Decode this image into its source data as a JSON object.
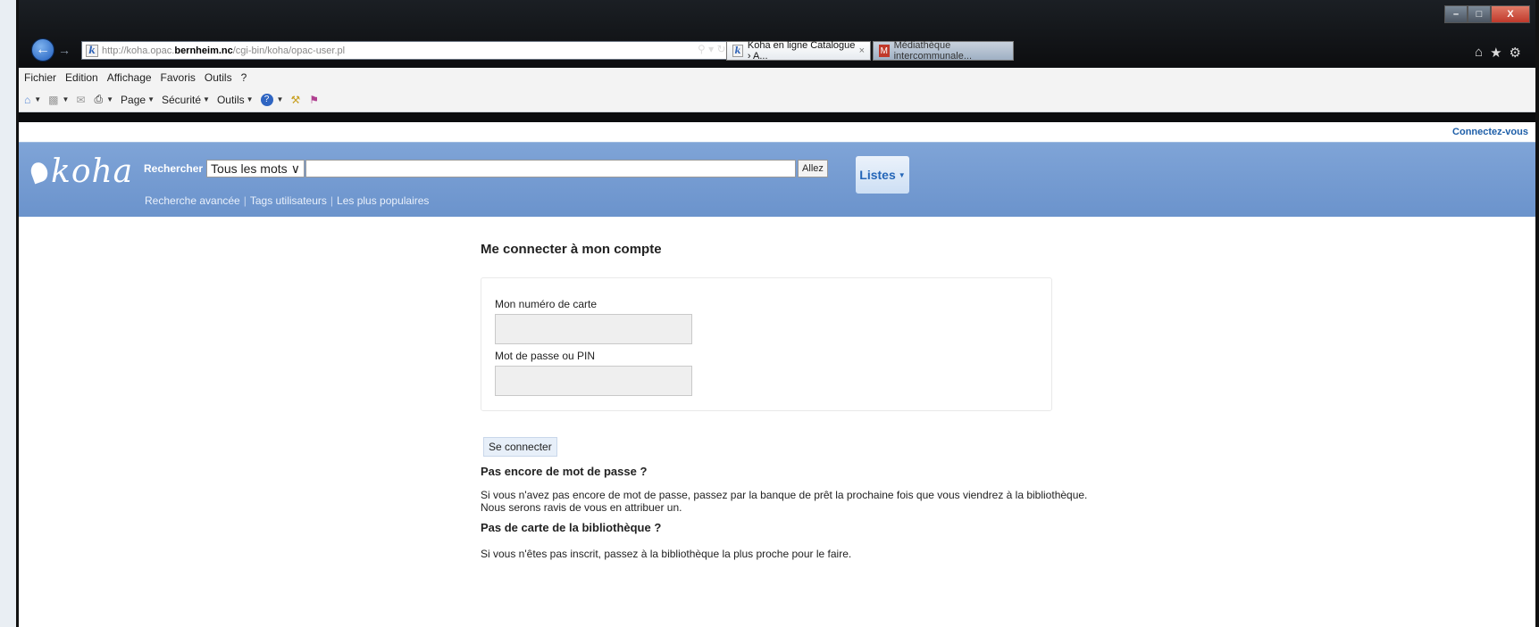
{
  "browser": {
    "address": {
      "prefix": "http://koha.opac.",
      "host": "bernheim.nc",
      "path": "/cgi-bin/koha/opac-user.pl"
    },
    "tabs": [
      {
        "label": "Koha en ligne Catalogue › A...",
        "close": "×"
      },
      {
        "label": "Médiathèque intercommunale..."
      }
    ],
    "menu": [
      "Fichier",
      "Edition",
      "Affichage",
      "Favoris",
      "Outils",
      "?"
    ],
    "command_bar": {
      "page": "Page",
      "security": "Sécurité",
      "tools": "Outils"
    },
    "caption": {
      "min": "–",
      "max": "□",
      "close": "X"
    }
  },
  "header": {
    "login_link": "Connectez-vous",
    "logo": "koha",
    "search_label": "Rechercher",
    "search_scope": "Tous les mots",
    "go_button": "Allez",
    "lists_button": "Listes",
    "sub_links": [
      "Recherche avancée",
      "Tags utilisateurs",
      "Les plus populaires"
    ]
  },
  "login": {
    "title": "Me connecter à mon compte",
    "card_label": "Mon numéro de carte",
    "password_label": "Mot de passe ou PIN",
    "submit": "Se connecter",
    "no_password_title": "Pas encore de mot de passe ?",
    "no_password_text_1": "Si vous n'avez pas encore de mot de passe, passez par la banque de prêt la prochaine fois que vous viendrez à la bibliothèque.",
    "no_password_text_2": "Nous serons ravis de vous en attribuer un.",
    "no_card_title": "Pas de carte de la bibliothèque ?",
    "no_card_text": "Si vous n'êtes pas inscrit, passez à la bibliothèque la plus proche pour le faire."
  },
  "colors": {
    "masthead": "#6b93cc",
    "link": "#1d5ea8",
    "lists_text": "#2566b8"
  }
}
